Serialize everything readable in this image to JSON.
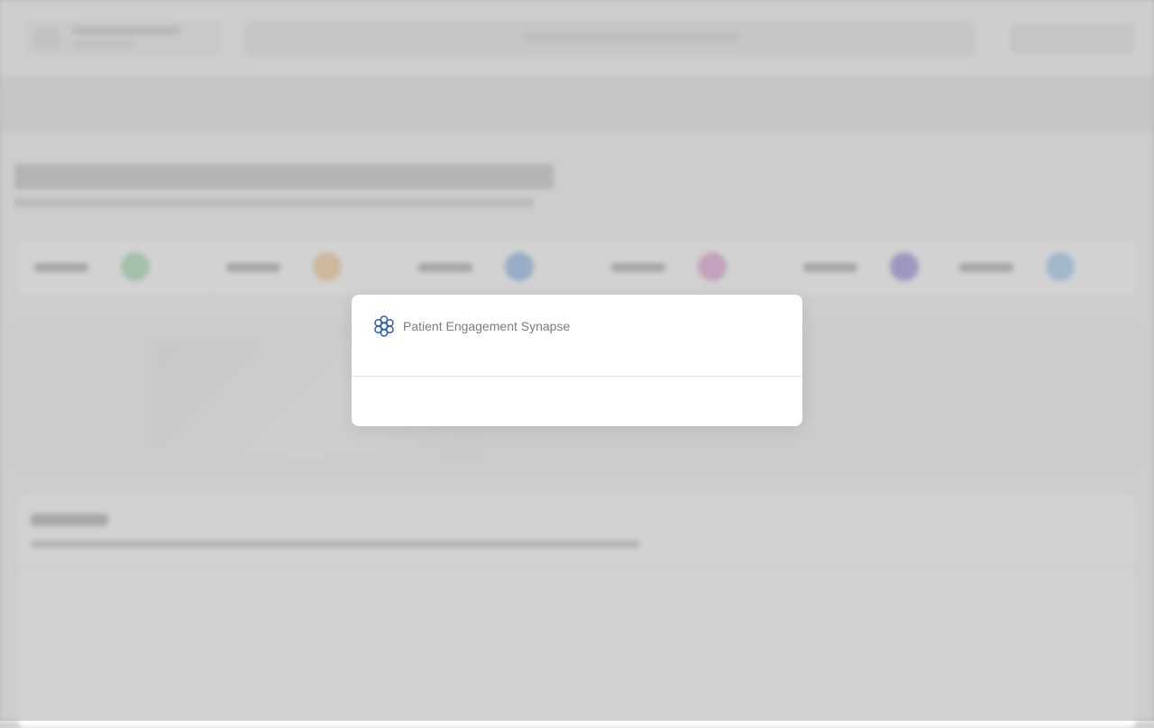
{
  "modal": {
    "brand_name": "Patient Engagement Synapse",
    "brand_icon": "network-cluster-icon",
    "brand_color": "#2f5fa8"
  },
  "background": {
    "stage_colors": [
      "#a7dcb0",
      "#f4cf98",
      "#8fb6e6",
      "#e3a3d6",
      "#9f8edc",
      "#a6cdf0"
    ],
    "overlay_color": "#a0a0a0"
  }
}
